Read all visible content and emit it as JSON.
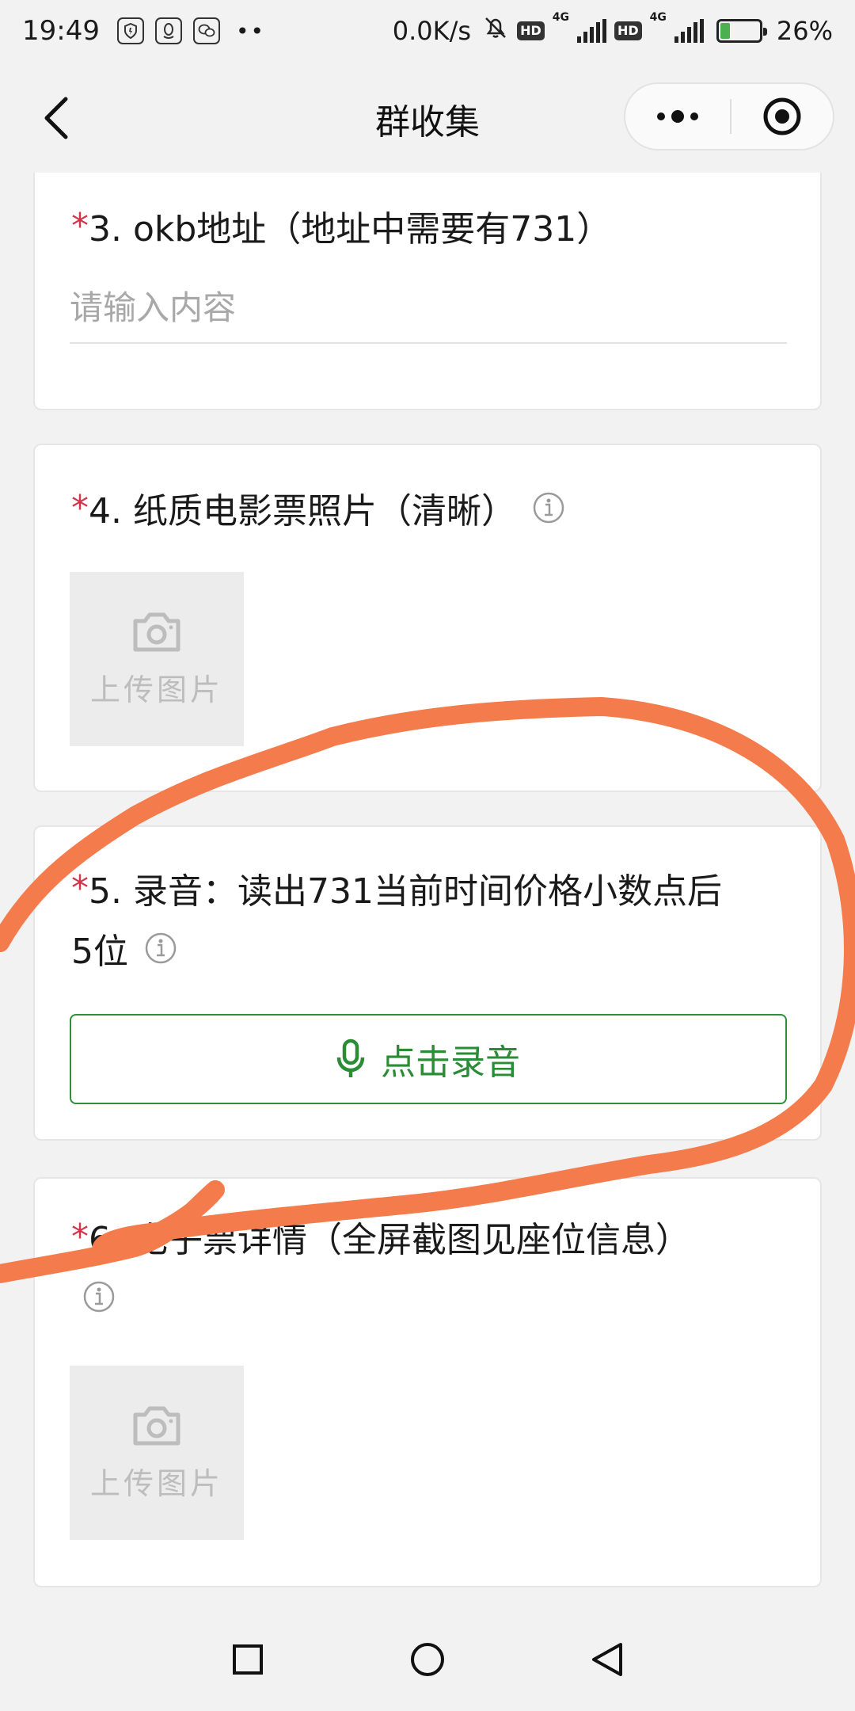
{
  "status_bar": {
    "time": "19:49",
    "net_speed": "0.0K/s",
    "hd_label": "HD",
    "network_type": "4G",
    "battery_percent": "26%",
    "battery_level": 0.26
  },
  "nav": {
    "title": "群收集"
  },
  "questions": [
    {
      "required_mark": "*",
      "title": "3. okb地址（地址中需要有731）",
      "placeholder": "请输入内容"
    },
    {
      "required_mark": "*",
      "title": "4. 纸质电影票照片（清晰）",
      "upload_label": "上传图片"
    },
    {
      "required_mark": "*",
      "title_line1": "5. 录音：读出731当前时间价格小数点后",
      "title_line2": "5位",
      "record_label": "点击录音"
    },
    {
      "required_mark": "*",
      "title": "6. 电子票详情（全屏截图见座位信息）",
      "upload_label": "上传图片"
    }
  ],
  "colors": {
    "required_star": "#d4344a",
    "accent_green": "#2a8c35",
    "annotation_stroke": "#f47c4c"
  }
}
